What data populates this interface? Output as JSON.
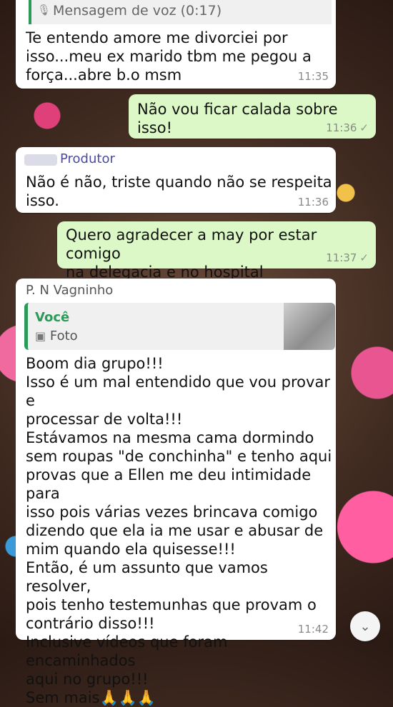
{
  "messages": [
    {
      "direction": "in",
      "voice_label": "Mensagem de voz (0:17)",
      "text": "Te entendo amore me divorciei por\nisso...meu ex marido tbm me pegou a\nforça...abre b.o msm",
      "time": "11:35"
    },
    {
      "direction": "out",
      "text": "Não vou ficar calada sobre isso!",
      "time": "11:36"
    },
    {
      "direction": "in",
      "sender": "Produtor",
      "text": "Não é não, triste quando não se respeita\nisso.",
      "time": "11:36"
    },
    {
      "direction": "out",
      "text": "Quero agradecer a may por estar comigo\nna delegacia e no hospital",
      "time": "11:37"
    },
    {
      "direction": "in",
      "sender": "P. N Vagninho",
      "quote": {
        "name": "Você",
        "type": "Foto"
      },
      "text": "Boom dia grupo!!!\nIsso é um mal entendido que vou provar e\nprocessar de volta!!!\nEstávamos na mesma cama dormindo\nsem roupas \"de conchinha\" e tenho aqui\nprovas que a Ellen me deu intimidade para\nisso pois várias vezes brincava comigo\ndizendo que ela ia me usar e abusar de\nmim quando ela quisesse!!!\nEntão, é um assunto que vamos resolver,\npois tenho testemunhas que provam o\ncontrário disso!!!\nInclusive vídeos que foram encaminhados\naqui no grupo!!!\nSem mais🙏🙏🙏",
      "time": "11:42"
    }
  ],
  "icons": {
    "mic": "🎙",
    "photo": "▣",
    "check": "✓",
    "scroll": "⌄"
  }
}
